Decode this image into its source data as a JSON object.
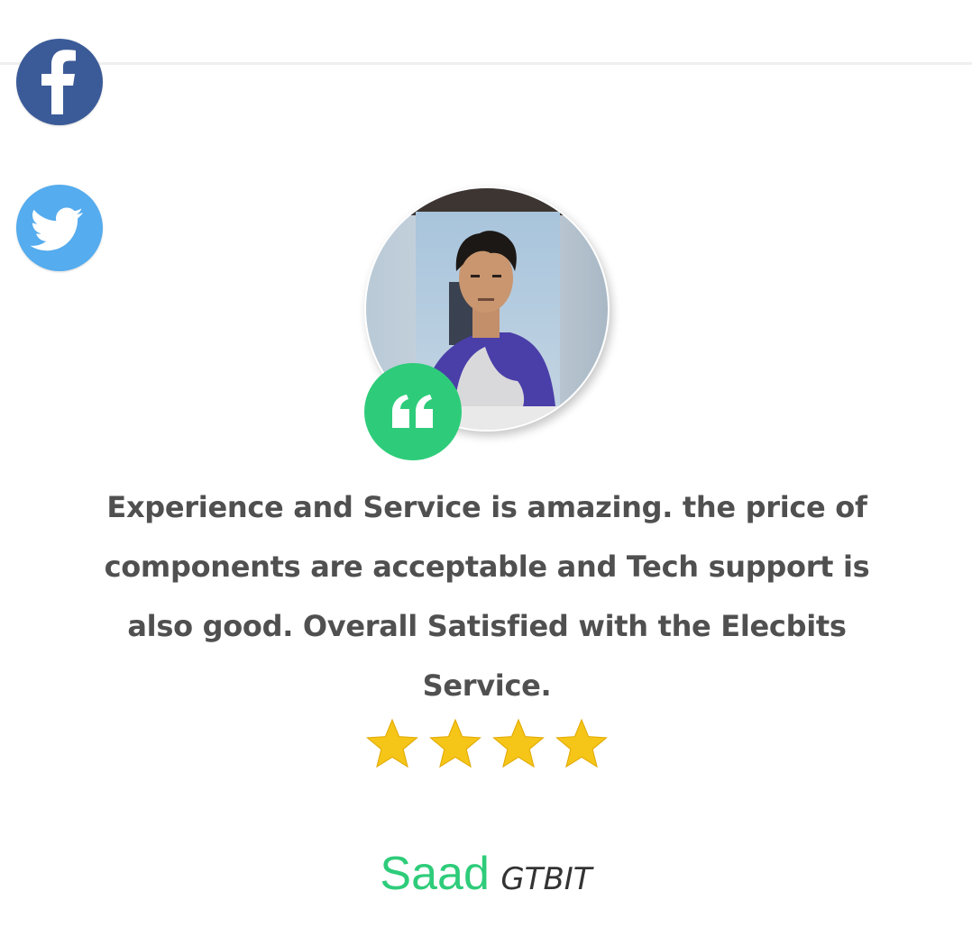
{
  "social": {
    "facebook_icon": "facebook-icon",
    "twitter_icon": "twitter-icon",
    "facebook_color": "#3b5b98",
    "twitter_color": "#55acee"
  },
  "testimonial": {
    "quote_icon": "quote-icon",
    "accent_color": "#2ecc7a",
    "text": "Experience and Service is amazing. the price of components are acceptable and Tech support is also good. Overall Satisfied with the Elecbits Service.",
    "rating": 4,
    "star_color": "#f5c518",
    "author_name": "Saad",
    "author_org": "GTBIT"
  }
}
